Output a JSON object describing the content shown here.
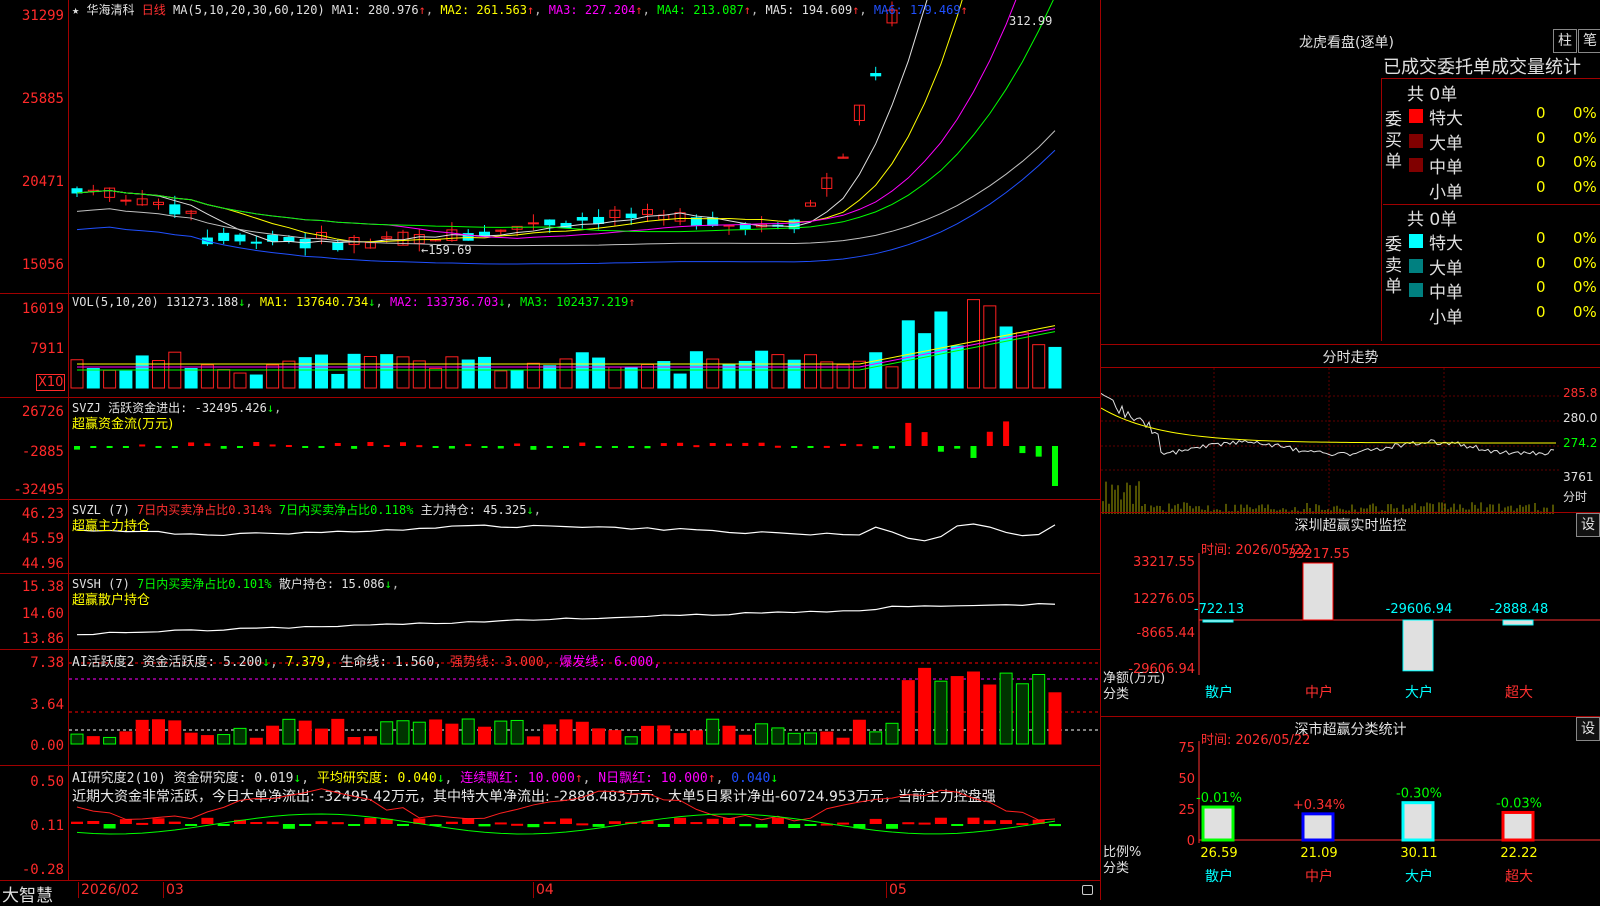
{
  "stock": {
    "star": "★",
    "name": "华海清科",
    "period": "日线"
  },
  "kline": {
    "ma_header_label": "MA(5,10,20,30,60,120)",
    "ma1": "MA1: 280.976",
    "ma2": "MA2: 261.563",
    "ma3": "MA3: 227.204",
    "ma4": "MA4: 213.087",
    "ma5": "MA5: 194.609",
    "ma6": "MA6: 179.469",
    "ticks": [
      "31299",
      "25885",
      "20471",
      "15056"
    ],
    "high_label": "312.99",
    "low_label": "←159.69"
  },
  "vol": {
    "label": "VOL(5,10,20)",
    "value": "131273.188",
    "ma1": "MA1: 137640.734",
    "ma2": "MA2: 133736.703",
    "ma3": "MA3: 102437.219",
    "ticks": [
      "16019",
      "7911"
    ],
    "unit": "X10"
  },
  "svzj": {
    "label": "SVZJ",
    "desc": "活跃资金进出: -32495.426",
    "sub": "超赢资金流(万元)",
    "ticks": [
      "26726",
      "-2885",
      "-32495"
    ]
  },
  "svzl": {
    "label": "SVZL (7)",
    "a": "7日内买卖净占比0.314%",
    "b": "7日内买卖净占比0.118%",
    "c": "主力持仓: 45.325",
    "sub": "超赢主力持仓",
    "ticks": [
      "46.23",
      "45.59",
      "44.96"
    ]
  },
  "svsh": {
    "label": "SVSH (7)",
    "a": "7日内买卖净占比0.101%",
    "c": "散户持仓: 15.086",
    "sub": "超赢散户持仓",
    "ticks": [
      "15.38",
      "14.60",
      "13.86"
    ]
  },
  "ai1": {
    "label": "AI活跃度2",
    "a": "资金活跃度: 5.200",
    "b": "7.379,",
    "c": "生命线: 1.560,",
    "d": "强势线: 3.000,",
    "e": "爆发线: 6.000,",
    "ticks": [
      "7.38",
      "3.64",
      "0.00"
    ]
  },
  "ai2": {
    "label": "AI研究度2(10)",
    "a": "资金研究度: 0.019",
    "b": "平均研究度: 0.040",
    "c": "连续飘红: 10.000",
    "d": "N日飘红: 10.000",
    "e": "0.040",
    "ticks": [
      "0.50",
      "0.11",
      "-0.28"
    ],
    "message": "近期大资金非常活跃，今日大单净流出: -32495.42万元，其中特大单净流出: -2888.483万元，大单5日累计净出-60724.953万元，当前主力控盘强"
  },
  "status": {
    "brand": "大智慧",
    "dates": [
      "2026/02",
      "03",
      "04",
      "05"
    ]
  },
  "lhb": {
    "title": "龙虎看盘(逐单)",
    "btn1": "柱",
    "btn2": "笔",
    "header": "已成交委托单成交量统计",
    "buy_label": "委买单",
    "sell_label": "委卖单",
    "buy_total": "共 0单",
    "sell_total": "共 0单",
    "buy_rows": [
      {
        "name": "特大",
        "n": "0",
        "p": "0%",
        "color": "#ff0000"
      },
      {
        "name": "大单",
        "n": "0",
        "p": "0%",
        "color": "#800000"
      },
      {
        "name": "中单",
        "n": "0",
        "p": "0%",
        "color": "#800000"
      },
      {
        "name": "小单",
        "n": "0",
        "p": "0%",
        "color": "#000000"
      }
    ],
    "sell_rows": [
      {
        "name": "特大",
        "n": "0",
        "p": "0%",
        "color": "#00ffff"
      },
      {
        "name": "大单",
        "n": "0",
        "p": "0%",
        "color": "#008080"
      },
      {
        "name": "中单",
        "n": "0",
        "p": "0%",
        "color": "#008080"
      },
      {
        "name": "小单",
        "n": "0",
        "p": "0%",
        "color": "#000000"
      }
    ]
  },
  "fs": {
    "title": "分时走势",
    "ticks": [
      "285.8",
      "280.0",
      "274.2",
      "3761",
      "分时"
    ]
  },
  "szmon": {
    "title": "深圳超赢实时监控",
    "btn": "设",
    "time": "时间: 2026/05/22",
    "ticks": [
      "33217.55",
      "12276.05",
      "-8665.44",
      "-29606.94"
    ],
    "ylabel": "净额(万元)",
    "xlabel": "分类",
    "bars": [
      {
        "name": "散户",
        "value": "-722.13"
      },
      {
        "name": "中户",
        "value": "33217.55"
      },
      {
        "name": "大户",
        "value": "-29606.94"
      },
      {
        "name": "超大",
        "value": "-2888.48"
      }
    ]
  },
  "szcls": {
    "title": "深市超赢分类统计",
    "btn": "设",
    "time": "时间: 2026/05/22",
    "ticks": [
      "75",
      "50",
      "25",
      "0"
    ],
    "ylabel": "比例%",
    "xlabel": "分类",
    "bars": [
      {
        "name": "散户",
        "value": "26.59",
        "delta": "-0.01%"
      },
      {
        "name": "中户",
        "value": "21.09",
        "delta": "+0.34%"
      },
      {
        "name": "大户",
        "value": "30.11",
        "delta": "-0.30%"
      },
      {
        "name": "超大",
        "value": "22.22",
        "delta": "-0.03%"
      }
    ]
  }
}
